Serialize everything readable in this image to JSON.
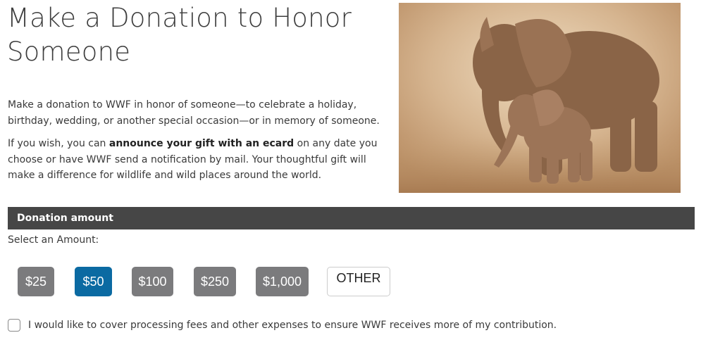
{
  "page": {
    "title": "Make a Donation to Honor Someone",
    "intro_paragraph": "Make a donation to WWF in honor of someone—to celebrate a holiday, birthday, wedding, or another special occasion—or in memory of someone.",
    "ecard_prefix": "If you wish, you can ",
    "ecard_link": "announce your gift with an ecard",
    "ecard_suffix": " on any date you choose or have WWF send a notification by mail. Your thoughtful gift will make a difference for wildlife and wild places around the world."
  },
  "hero_image": {
    "subject": "adult elephant walking with calf in dust"
  },
  "donation": {
    "section_title": "Donation amount",
    "select_label": "Select an Amount:",
    "amounts": [
      {
        "label": "$25",
        "selected": false
      },
      {
        "label": "$50",
        "selected": true
      },
      {
        "label": "$100",
        "selected": false
      },
      {
        "label": "$250",
        "selected": false
      },
      {
        "label": "$1,000",
        "selected": false
      }
    ],
    "other_label": "OTHER",
    "fee_checkbox_label": "I would like to cover processing fees and other expenses to ensure WWF receives more of my contribution.",
    "fee_checkbox_checked": false
  },
  "colors": {
    "selected_amount": "#0b6aa2",
    "unselected_amount": "#7b7b7d",
    "section_bar": "#464646"
  }
}
